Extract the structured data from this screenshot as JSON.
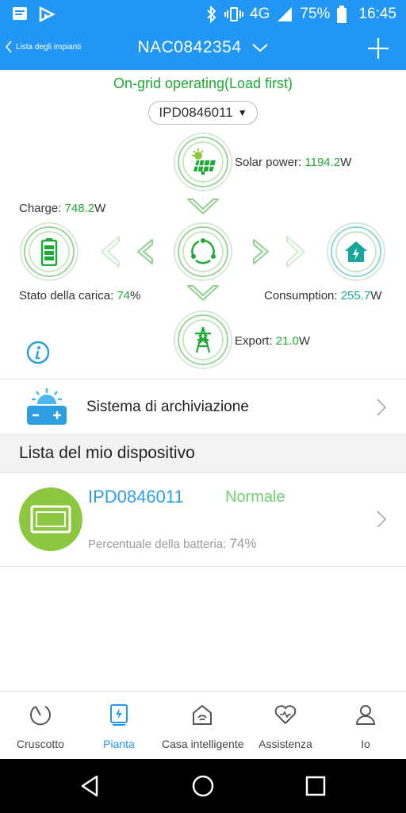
{
  "status_bar": {
    "network": "4G",
    "network_badge": "4G",
    "battery_percent": "75%",
    "time": "16:45",
    "icons": [
      "message-icon",
      "play-store-icon",
      "bluetooth-icon",
      "vibrate-icon",
      "signal-icon",
      "battery-icon"
    ]
  },
  "header": {
    "back_label": "Lista degli impianti",
    "plant_id": "NAC0842354"
  },
  "flow": {
    "mode": "On-grid operating(Load first)",
    "device": "IPD0846011",
    "solar_label": "Solar power: ",
    "solar_value": "1194.2",
    "solar_unit": "W",
    "charge_label": "Charge: ",
    "charge_value": "748.2",
    "charge_unit": "W",
    "soc_label": "Stato della carica: ",
    "soc_value": "74",
    "soc_unit": "%",
    "consumption_label": "Consumption: ",
    "consumption_value": "255.7",
    "consumption_unit": "W",
    "export_label": "Export: ",
    "export_value": "21.0",
    "export_unit": "W"
  },
  "storage": {
    "label": "Sistema di archiviazione"
  },
  "device_list": {
    "title": "Lista del mio dispositivo",
    "items": [
      {
        "name": "IPD0846011",
        "state": "Normale",
        "battery_label": "Percentuale della batteria: ",
        "battery_value": "74%"
      }
    ]
  },
  "tabs": [
    {
      "label": "Cruscotto",
      "icon": "dashboard-icon"
    },
    {
      "label": "Pianta",
      "icon": "plant-icon",
      "active": true
    },
    {
      "label": "Casa intelligente",
      "icon": "smart-home-icon"
    },
    {
      "label": "Assistenza",
      "icon": "support-icon"
    },
    {
      "label": "Io",
      "icon": "profile-icon"
    }
  ],
  "colors": {
    "primary": "#2196f3",
    "green": "#1eaa35",
    "teal": "#17a69a",
    "avatar": "#8dc63f"
  }
}
